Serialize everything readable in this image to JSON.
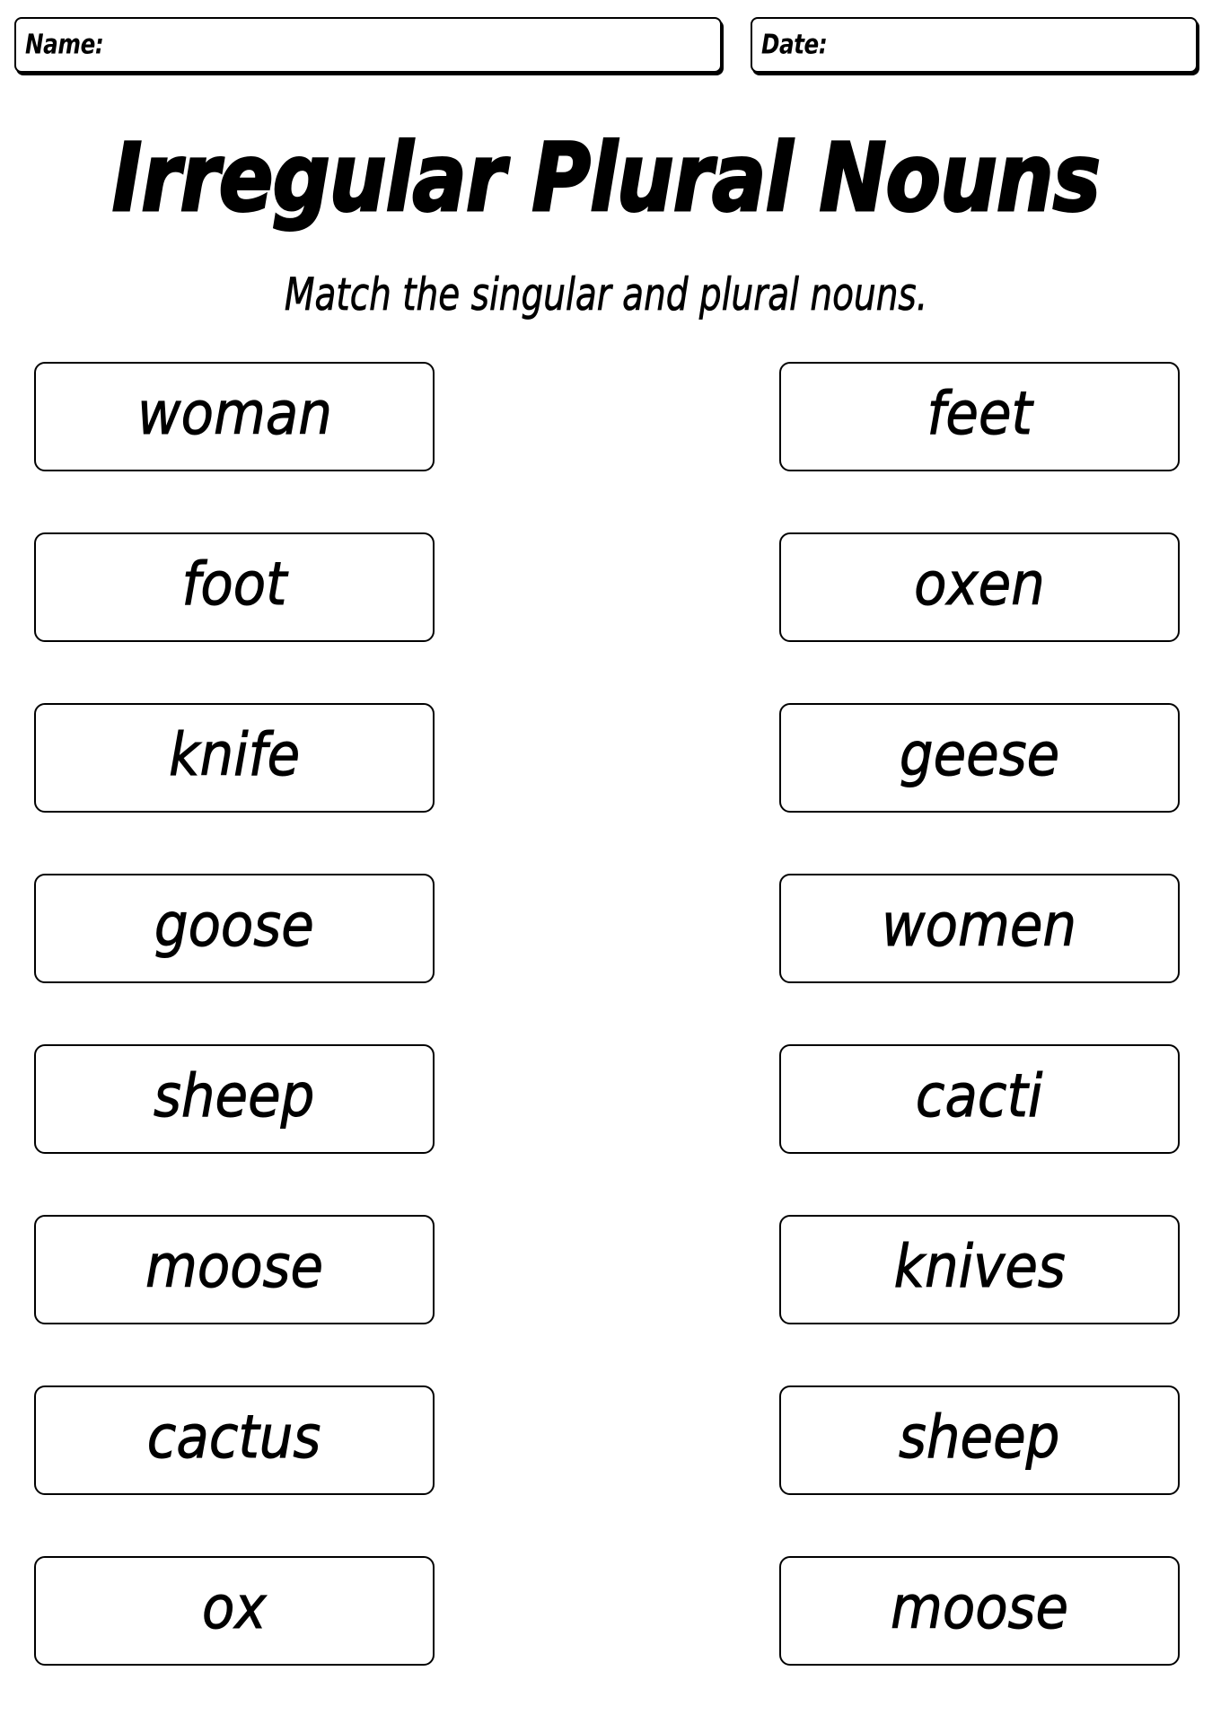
{
  "header": {
    "name_label": "Name:",
    "date_label": "Date:"
  },
  "title": "Irregular Plural Nouns",
  "instructions": "Match the singular and plural nouns.",
  "singular": [
    "woman",
    "foot",
    "knife",
    "goose",
    "sheep",
    "moose",
    "cactus",
    "ox"
  ],
  "plural": [
    "feet",
    "oxen",
    "geese",
    "women",
    "cacti",
    "knives",
    "sheep",
    "moose"
  ]
}
